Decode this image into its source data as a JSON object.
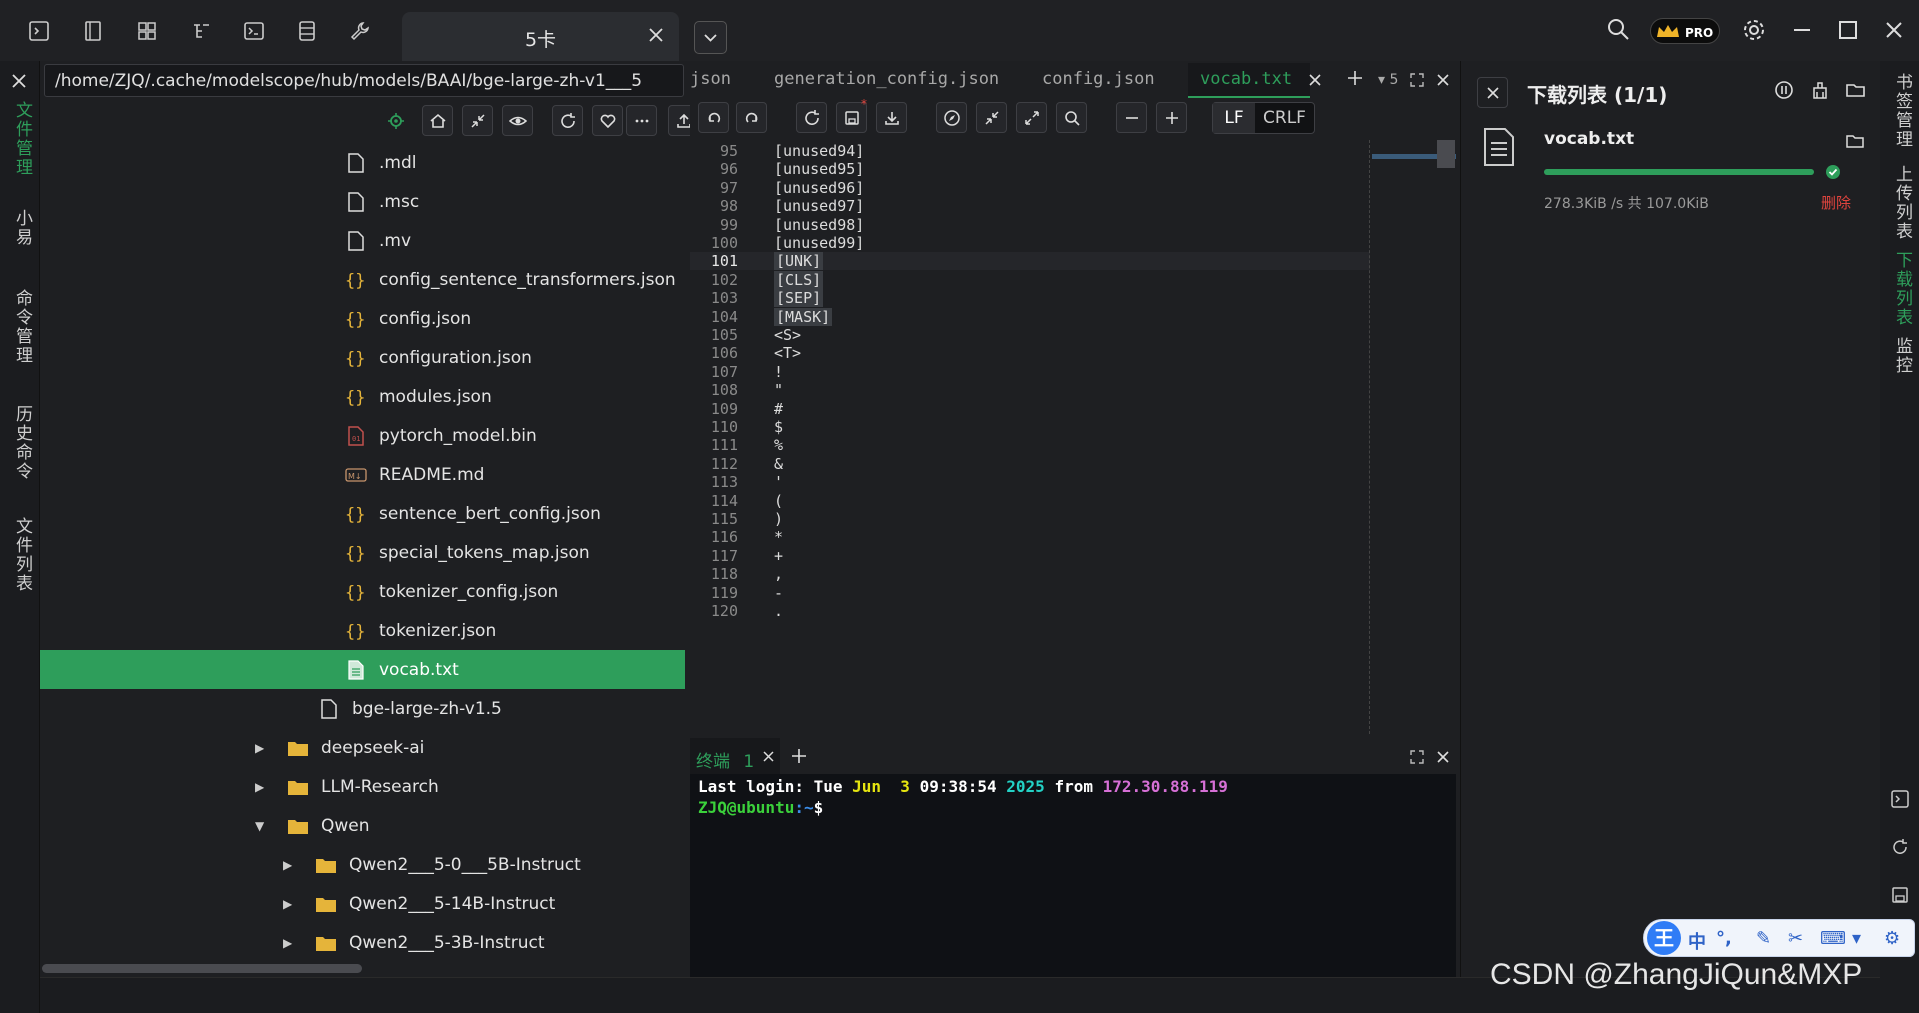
{
  "session_tab": {
    "label": "5卡"
  },
  "left_rail": {
    "items": [
      "文件管理",
      "小易",
      "命令管理",
      "历史命令",
      "文件列表"
    ]
  },
  "right_rail": {
    "items": [
      "书签管理",
      "上传列表",
      "下载列表",
      "监控"
    ]
  },
  "file_panel": {
    "path": "/home/ZJQ/.cache/modelscope/hub/models/BAAI/bge-large-zh-v1___5",
    "rows": [
      {
        "name": ".mdl",
        "icon": "file-icon",
        "indent": 2
      },
      {
        "name": ".msc",
        "icon": "file-icon",
        "indent": 2
      },
      {
        "name": ".mv",
        "icon": "file-icon",
        "indent": 2
      },
      {
        "name": "config_sentence_transformers.json",
        "icon": "json-icon",
        "indent": 2
      },
      {
        "name": "config.json",
        "icon": "json-icon",
        "indent": 2
      },
      {
        "name": "configuration.json",
        "icon": "json-icon",
        "indent": 2
      },
      {
        "name": "modules.json",
        "icon": "json-icon",
        "indent": 2
      },
      {
        "name": "pytorch_model.bin",
        "icon": "binary-icon",
        "indent": 2
      },
      {
        "name": "README.md",
        "icon": "markdown-icon",
        "indent": 2
      },
      {
        "name": "sentence_bert_config.json",
        "icon": "json-icon",
        "indent": 2
      },
      {
        "name": "special_tokens_map.json",
        "icon": "json-icon",
        "indent": 2
      },
      {
        "name": "tokenizer_config.json",
        "icon": "json-icon",
        "indent": 2
      },
      {
        "name": "tokenizer.json",
        "icon": "json-icon",
        "indent": 2
      },
      {
        "name": "vocab.txt",
        "icon": "text-icon",
        "indent": 2,
        "selected": true
      },
      {
        "name": "bge-large-zh-v1.5",
        "icon": "file-icon",
        "indent": 1
      },
      {
        "name": "deepseek-ai",
        "icon": "folder-icon",
        "indent": 0,
        "arrow": "right"
      },
      {
        "name": "LLM-Research",
        "icon": "folder-icon",
        "indent": 0,
        "arrow": "right"
      },
      {
        "name": "Qwen",
        "icon": "folder-icon",
        "indent": 0,
        "arrow": "down"
      },
      {
        "name": "Qwen2___5-0___5B-Instruct",
        "icon": "folder-icon",
        "indent": 1,
        "arrow": "right"
      },
      {
        "name": "Qwen2___5-14B-Instruct",
        "icon": "folder-icon",
        "indent": 1,
        "arrow": "right"
      },
      {
        "name": "Qwen2___5-3B-Instruct",
        "icon": "folder-icon",
        "indent": 1,
        "arrow": "right"
      }
    ]
  },
  "editor": {
    "tabs": [
      "json",
      "generation_config.json",
      "config.json",
      "vocab.txt"
    ],
    "active_tab": "vocab.txt",
    "tab_count": "5",
    "eol": {
      "lf": "LF",
      "crlf": "CRLF"
    },
    "lines": [
      {
        "n": "95",
        "t": "[unused94]"
      },
      {
        "n": "96",
        "t": "[unused95]"
      },
      {
        "n": "97",
        "t": "[unused96]"
      },
      {
        "n": "98",
        "t": "[unused97]"
      },
      {
        "n": "99",
        "t": "[unused98]"
      },
      {
        "n": "100",
        "t": "[unused99]"
      },
      {
        "n": "101",
        "t": "[UNK]",
        "hl": true,
        "cur": true
      },
      {
        "n": "102",
        "t": "[CLS]",
        "hl": true
      },
      {
        "n": "103",
        "t": "[SEP]",
        "hl": true
      },
      {
        "n": "104",
        "t": "[MASK]",
        "hl": true
      },
      {
        "n": "105",
        "t": "<S>"
      },
      {
        "n": "106",
        "t": "<T>"
      },
      {
        "n": "107",
        "t": "!"
      },
      {
        "n": "108",
        "t": "\""
      },
      {
        "n": "109",
        "t": "#"
      },
      {
        "n": "110",
        "t": "$"
      },
      {
        "n": "111",
        "t": "%"
      },
      {
        "n": "112",
        "t": "&"
      },
      {
        "n": "113",
        "t": "'"
      },
      {
        "n": "114",
        "t": "("
      },
      {
        "n": "115",
        "t": ")"
      },
      {
        "n": "116",
        "t": "*"
      },
      {
        "n": "117",
        "t": "+"
      },
      {
        "n": "118",
        "t": ","
      },
      {
        "n": "119",
        "t": "-"
      },
      {
        "n": "120",
        "t": "."
      }
    ]
  },
  "terminal": {
    "tab_label": "终端",
    "tab_number": "1",
    "last_login": {
      "prefix": "Last login: Tue ",
      "month": "Jun",
      "day": "  3",
      "time": " 09:38:54",
      "year": " 2025",
      "from": " from ",
      "ip": "172.30.88.119"
    },
    "prompt_user": "ZJQ@ubuntu",
    "prompt_path": ":~",
    "prompt_sign": "$"
  },
  "download": {
    "title": "下载列表 (1/1)",
    "item_name": "vocab.txt",
    "progress": 1.0,
    "speed": "278.3KiB /s  共 107.0KiB",
    "delete_label": "删除"
  },
  "ime": {
    "logo": "王",
    "mode": "中"
  },
  "watermark": "CSDN @ZhangJiQun&MXP",
  "colors": {
    "accent": "#2e9e5b",
    "delete": "#e0443e",
    "term_month": "#e5e510",
    "term_time": "#ffffff",
    "term_year": "#23d1c5",
    "term_ip": "#d670d6",
    "term_user": "#3bd13b",
    "term_path": "#3b8eea"
  }
}
